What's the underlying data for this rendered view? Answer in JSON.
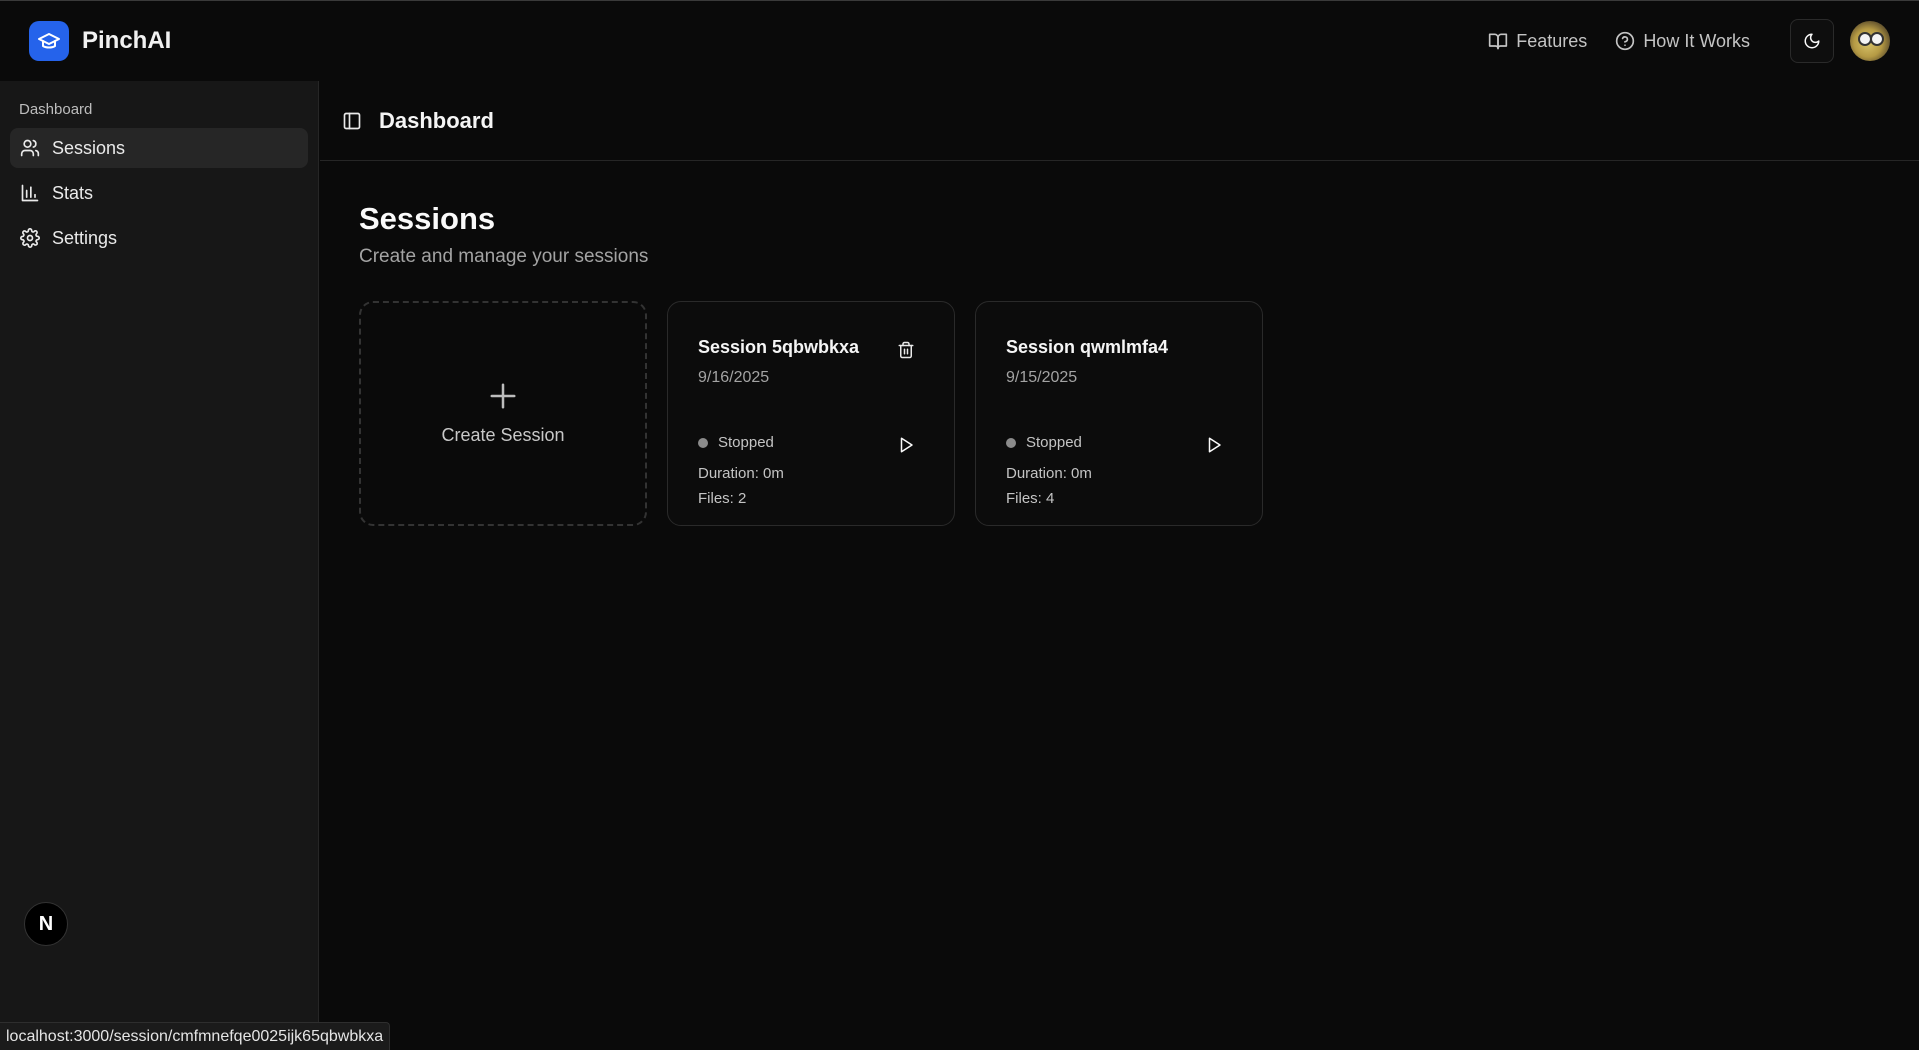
{
  "brand": {
    "name": "PinchAI",
    "accent": "#2563eb"
  },
  "topnav": {
    "features": "Features",
    "how_it_works": "How It Works"
  },
  "sidebar": {
    "section_label": "Dashboard",
    "items": [
      {
        "label": "Sessions",
        "icon": "users-icon",
        "active": true
      },
      {
        "label": "Stats",
        "icon": "bar-chart-icon",
        "active": false
      },
      {
        "label": "Settings",
        "icon": "gear-icon",
        "active": false
      }
    ]
  },
  "header": {
    "title": "Dashboard"
  },
  "page": {
    "title": "Sessions",
    "subtitle": "Create and manage your sessions"
  },
  "create_card": {
    "label": "Create Session"
  },
  "sessions": [
    {
      "name": "Session 5qbwbkxa",
      "date": "9/16/2025",
      "status": "Stopped",
      "duration": "Duration: 0m",
      "files": "Files: 2"
    },
    {
      "name": "Session qwmlmfa4",
      "date": "9/15/2025",
      "status": "Stopped",
      "duration": "Duration: 0m",
      "files": "Files: 4"
    }
  ],
  "next_badge": "N",
  "status_url": "localhost:3000/session/cmfmnefqe0025ijk65qbwbkxa"
}
